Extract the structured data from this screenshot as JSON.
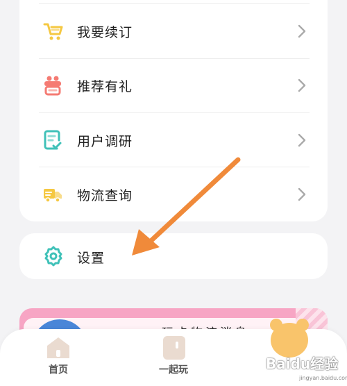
{
  "menu": {
    "items": [
      {
        "label": "我要续订",
        "icon": "renew-cart-icon",
        "color": "#f5c842"
      },
      {
        "label": "推荐有礼",
        "icon": "gift-icon",
        "color": "#f57b73"
      },
      {
        "label": "用户调研",
        "icon": "survey-icon",
        "color": "#3fc1b8"
      },
      {
        "label": "物流查询",
        "icon": "delivery-truck-icon",
        "color": "#f5c842"
      }
    ]
  },
  "settings": {
    "label": "设置",
    "icon": "gear-icon",
    "color": "#3fc1b8"
  },
  "banner": {
    "title": "玩卡物流消息",
    "color": "#f7a5c4"
  },
  "tabbar": {
    "tabs": [
      {
        "label": "首页",
        "icon": "home-icon"
      },
      {
        "label": "一起玩",
        "icon": "play-together-icon"
      }
    ]
  },
  "annotation": {
    "arrow_color": "#f08a3a"
  },
  "watermark": {
    "brand": "Baidu经验",
    "url": "jingyan.baidu.com"
  }
}
